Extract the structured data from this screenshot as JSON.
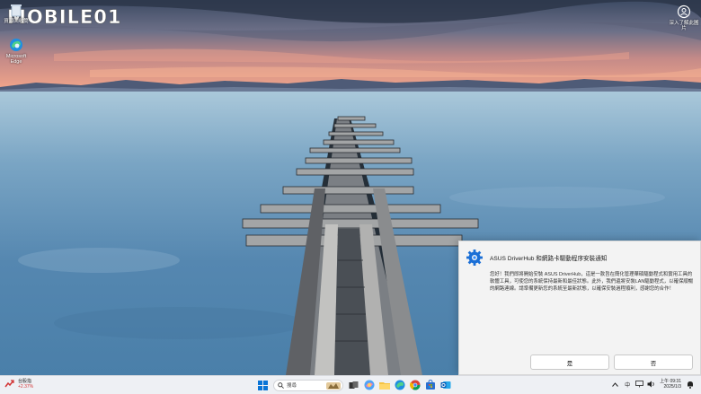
{
  "desktop": {
    "icons": [
      {
        "label": "資源回收筒",
        "icon": "recycle-bin-icon"
      },
      {
        "label": "Microsoft Edge",
        "icon": "edge-icon"
      }
    ],
    "user_shortcut": {
      "label": "深入了解此圖片",
      "icon": "user-circle-icon"
    }
  },
  "watermark": {
    "text": "MOBILE01"
  },
  "dialog": {
    "title": "ASUS DriverHub 和網路卡驅動程序安裝通知",
    "body": "您好！我們即將開始安裝 ASUS DriverHub，這是一款旨在簡化管理華碩驅動程式和實用工具的軟體工具，可使您的系統保持最新和最佳狀態。此外，我們還將安裝LAN驅動程式，以確保順暢的網路連線。請準備更新您的系統至最新狀態，以確保安裝過程順利，感謝您的合作！",
    "yes_label": "是",
    "no_label": "否",
    "icon": "asus-driverhub-gear-icon"
  },
  "taskbar": {
    "stock": {
      "name": "台股指",
      "change": "+2.37%",
      "icon": "stock-chart-icon"
    },
    "search_placeholder": "搜尋",
    "apps": [
      "start-icon",
      "task-view-icon",
      "copilot-icon",
      "file-explorer-icon",
      "edge-icon",
      "chrome-icon",
      "store-icon",
      "outlook-icon"
    ],
    "lang": "中",
    "time": "上午 09:31",
    "date": "2025/1/3"
  },
  "colors": {
    "accent": "#0067c0",
    "stock_down": "#d23434",
    "dialog_bg": "#f3f3f3"
  }
}
